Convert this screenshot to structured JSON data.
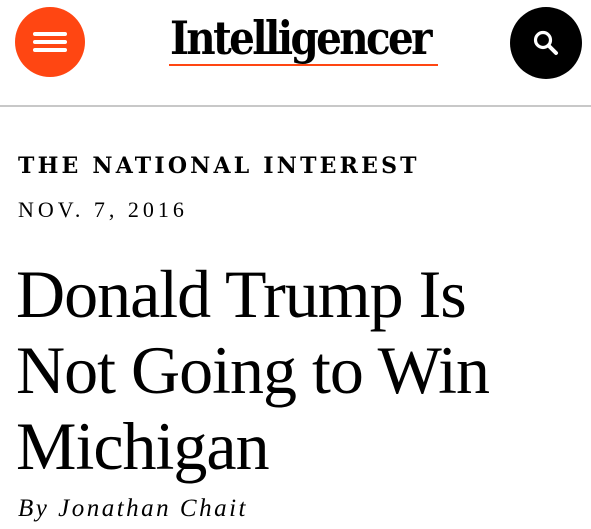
{
  "header": {
    "logo_text": "Intelligencer",
    "menu_icon": "hamburger-menu-icon",
    "search_icon": "search-icon",
    "colors": {
      "accent": "#ff4612",
      "search_button": "#000000",
      "divider": "#c8c8c8"
    }
  },
  "article": {
    "kicker": "THE NATIONAL INTEREST",
    "date": "NOV. 7, 2016",
    "headline": "Donald Trump Is Not Going to Win Michigan",
    "byline": "By Jonathan Chait"
  }
}
